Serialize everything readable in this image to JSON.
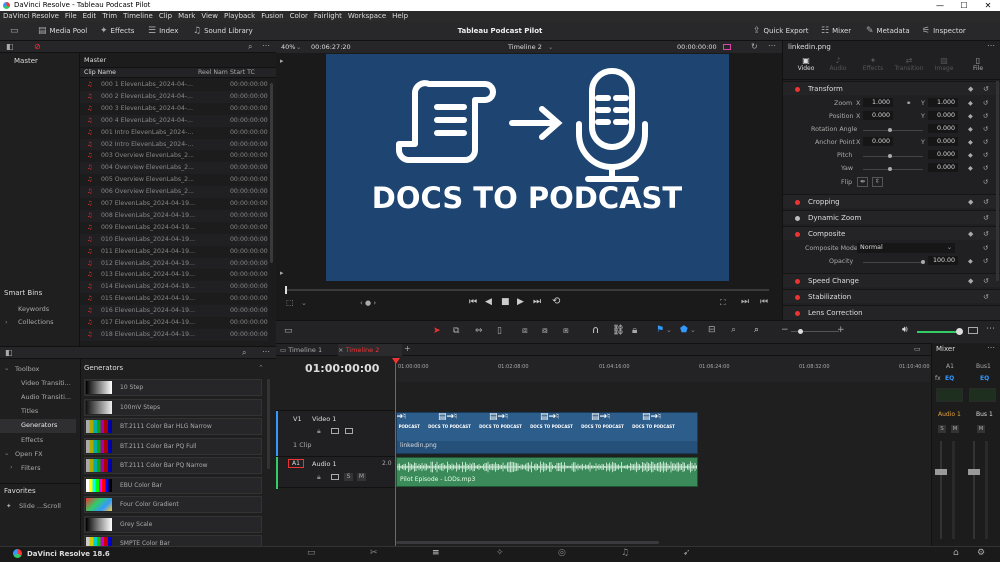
{
  "window": {
    "title": "DaVinci Resolve - Tableau Podcast Pilot",
    "controls": [
      "—",
      "☐",
      "✕"
    ]
  },
  "menu": [
    "DaVinci Resolve",
    "File",
    "Edit",
    "Trim",
    "Timeline",
    "Clip",
    "Mark",
    "View",
    "Playback",
    "Fusion",
    "Color",
    "Fairlight",
    "Workspace",
    "Help"
  ],
  "toolbar": {
    "media_pool": "Media Pool",
    "effects": "Effects",
    "index": "Index",
    "sound_library": "Sound Library",
    "project": "Tableau Podcast Pilot",
    "quick_export": "Quick Export",
    "mixer": "Mixer",
    "metadata": "Metadata",
    "inspector": "Inspector"
  },
  "media": {
    "master_bin": "Master",
    "master_label": "Master",
    "headers": [
      "Clip Name",
      "Reel Nam",
      "Start TC"
    ],
    "clips": [
      {
        "name": "000 1 ElevenLabs_2024-04-...",
        "tc": "00:00:00:00"
      },
      {
        "name": "000 2 ElevenLabs_2024-04-...",
        "tc": "00:00:00:00"
      },
      {
        "name": "000 3 ElevenLabs_2024-04-...",
        "tc": "00:00:00:00"
      },
      {
        "name": "000 4 ElevenLabs_2024-04-...",
        "tc": "00:00:00:00"
      },
      {
        "name": "001 Intro ElevenLabs_2024-...",
        "tc": "00:00:00:00"
      },
      {
        "name": "002 Intro ElevenLabs_2024-...",
        "tc": "00:00:00:00"
      },
      {
        "name": "003 Overview ElevenLabs_2...",
        "tc": "00:00:00:00"
      },
      {
        "name": "004 Overview ElevenLabs_2...",
        "tc": "00:00:00:00"
      },
      {
        "name": "005 Overview ElevenLabs_2...",
        "tc": "00:00:00:00"
      },
      {
        "name": "006 Overview ElevenLabs_2...",
        "tc": "00:00:00:00"
      },
      {
        "name": "007 ElevenLabs_2024-04-19...",
        "tc": "00:00:00:00"
      },
      {
        "name": "008 ElevenLabs_2024-04-19...",
        "tc": "00:00:00:00"
      },
      {
        "name": "009 ElevenLabs_2024-04-19...",
        "tc": "00:00:00:00"
      },
      {
        "name": "010 ElevenLabs_2024-04-19...",
        "tc": "00:00:00:00"
      },
      {
        "name": "011 ElevenLabs_2024-04-19...",
        "tc": "00:00:00:00"
      },
      {
        "name": "012 ElevenLabs_2024-04-19...",
        "tc": "00:00:00:00"
      },
      {
        "name": "013 ElevenLabs_2024-04-19...",
        "tc": "00:00:00:00"
      },
      {
        "name": "014 ElevenLabs_2024-04-19...",
        "tc": "00:00:00:00"
      },
      {
        "name": "015 ElevenLabs_2024-04-19...",
        "tc": "00:00:00:00"
      },
      {
        "name": "016 ElevenLabs_2024-04-19...",
        "tc": "00:00:00:00"
      },
      {
        "name": "017 ElevenLabs_2024-04-19...",
        "tc": "00:00:00:00"
      },
      {
        "name": "018 ElevenLabs_2024-04-19...",
        "tc": "00:00:00:00"
      }
    ],
    "smart_bins": "Smart Bins",
    "keywords": "Keywords",
    "collections": "Collections"
  },
  "viewer": {
    "zoom": "40%",
    "duration": "00:06:27:20",
    "timeline_name": "Timeline 2",
    "timecode": "00:00:00:00",
    "title_text": "DOCS TO PODCAST"
  },
  "inspector": {
    "clip": "linkedin.png",
    "tabs": [
      "Video",
      "Audio",
      "Effects",
      "Transition",
      "Image",
      "File"
    ],
    "transform": "Transform",
    "zoom_label": "Zoom",
    "zoom_x": "1.000",
    "zoom_y": "1.000",
    "position_label": "Position",
    "pos_x": "0.000",
    "pos_y": "0.000",
    "rotation_label": "Rotation Angle",
    "rotation": "0.000",
    "anchor_label": "Anchor Point",
    "anchor_x": "0.000",
    "anchor_y": "0.000",
    "pitch_label": "Pitch",
    "pitch": "0.000",
    "yaw_label": "Yaw",
    "yaw": "0.000",
    "flip_label": "Flip",
    "x": "X",
    "y": "Y",
    "cropping": "Cropping",
    "dynamic_zoom": "Dynamic Zoom",
    "composite": "Composite",
    "composite_mode_label": "Composite Mode",
    "composite_mode": "Normal",
    "opacity_label": "Opacity",
    "opacity": "100.00",
    "speed_change": "Speed Change",
    "stabilization": "Stabilization",
    "lens_correction": "Lens Correction"
  },
  "effects": {
    "toolbox": "Toolbox",
    "video_transitions": "Video Transiti...",
    "audio_transitions": "Audio Transiti...",
    "titles": "Titles",
    "generators": "Generators",
    "effects": "Effects",
    "open_fx": "Open FX",
    "filters": "Filters",
    "favorites": "Favorites",
    "fav_item": "Slide ...Scroll",
    "header": "Generators",
    "items": [
      "10 Step",
      "100mV Steps",
      "BT.2111 Color Bar HLG Narrow",
      "BT.2111 Color Bar PQ Full",
      "BT.2111 Color Bar PQ Narrow",
      "EBU Color Bar",
      "Four Color Gradient",
      "Grey Scale",
      "SMPTE Color Bar"
    ]
  },
  "timeline": {
    "tabs": [
      "Timeline 1",
      "Timeline 2"
    ],
    "timecode": "01:00:00:00",
    "ruler": [
      "01:00:00:00",
      "01:02:08:00",
      "01:04:16:00",
      "01:06:24:00",
      "01:08:32:00",
      "01:10:40:00"
    ],
    "v1": "V1",
    "video1": "Video 1",
    "clip_count": "1 Clip",
    "video_clip": "linkedin.png",
    "a1": "A1",
    "audio1": "Audio 1",
    "audio_level": "2.0",
    "audio_clip": "Pilot Episode - LODs.mp3",
    "tile_text": "DOCS TO PODCAST"
  },
  "mixer": {
    "title": "Mixer",
    "a1": "A1",
    "bus1": "Bus1",
    "audio1": "Audio 1",
    "bus1b": "Bus 1",
    "eq": "EQ",
    "fx": "fx",
    "s": "S",
    "m": "M"
  },
  "app": {
    "version": "DaVinci Resolve 18.6"
  },
  "colors": {
    "accent_red": "#e0393e",
    "frame_blue": "#1e4571",
    "clip_blue": "#2d5d8a",
    "clip_green": "#3a8a5a"
  }
}
